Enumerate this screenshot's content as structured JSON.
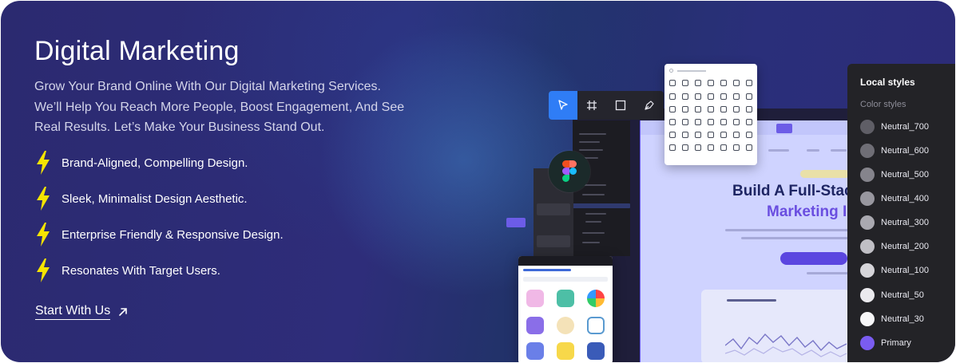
{
  "hero": {
    "title": "Digital Marketing",
    "description": "Grow Your Brand Online With Our Digital Marketing Services. We’ll Help You Reach More People, Boost Engagement, And See Real Results. Let’s Make Your Business Stand Out.",
    "features": [
      {
        "label": "Brand-Aligned, Compelling Design.",
        "icon": "lightning-bolt-icon"
      },
      {
        "label": "Sleek, Minimalist Design Aesthetic.",
        "icon": "lightning-bolt-icon"
      },
      {
        "label": "Enterprise Friendly & Responsive Design.",
        "icon": "lightning-bolt-icon"
      },
      {
        "label": "Resonates With Target Users.",
        "icon": "lightning-bolt-icon"
      }
    ],
    "cta_label": "Start With Us",
    "cta_icon": "arrow-up-right-icon"
  },
  "mockup": {
    "website_title_line1": "Build A Full-Stac",
    "website_title_line2": "Marketing I",
    "tools": [
      "cursor-icon",
      "frame-icon",
      "rectangle-icon",
      "pen-icon"
    ]
  },
  "styles_panel": {
    "title": "Local styles",
    "subtitle": "Color styles",
    "swatches": [
      {
        "name": "Neutral_700",
        "color": "#5f5e66"
      },
      {
        "name": "Neutral_600",
        "color": "#6f6e76"
      },
      {
        "name": "Neutral_500",
        "color": "#85848c"
      },
      {
        "name": "Neutral_400",
        "color": "#98979f"
      },
      {
        "name": "Neutral_300",
        "color": "#aaa9b0"
      },
      {
        "name": "Neutral_200",
        "color": "#c0bfc5"
      },
      {
        "name": "Neutral_100",
        "color": "#d6d5da"
      },
      {
        "name": "Neutral_50",
        "color": "#ebeaee"
      },
      {
        "name": "Neutral_30",
        "color": "#f6f6f8"
      },
      {
        "name": "Primary",
        "color": "#7a5cf0"
      }
    ]
  },
  "colors": {
    "accent_bolt": "#f5e400",
    "background": "#2c2b76",
    "tool_active": "#2f7df6"
  }
}
